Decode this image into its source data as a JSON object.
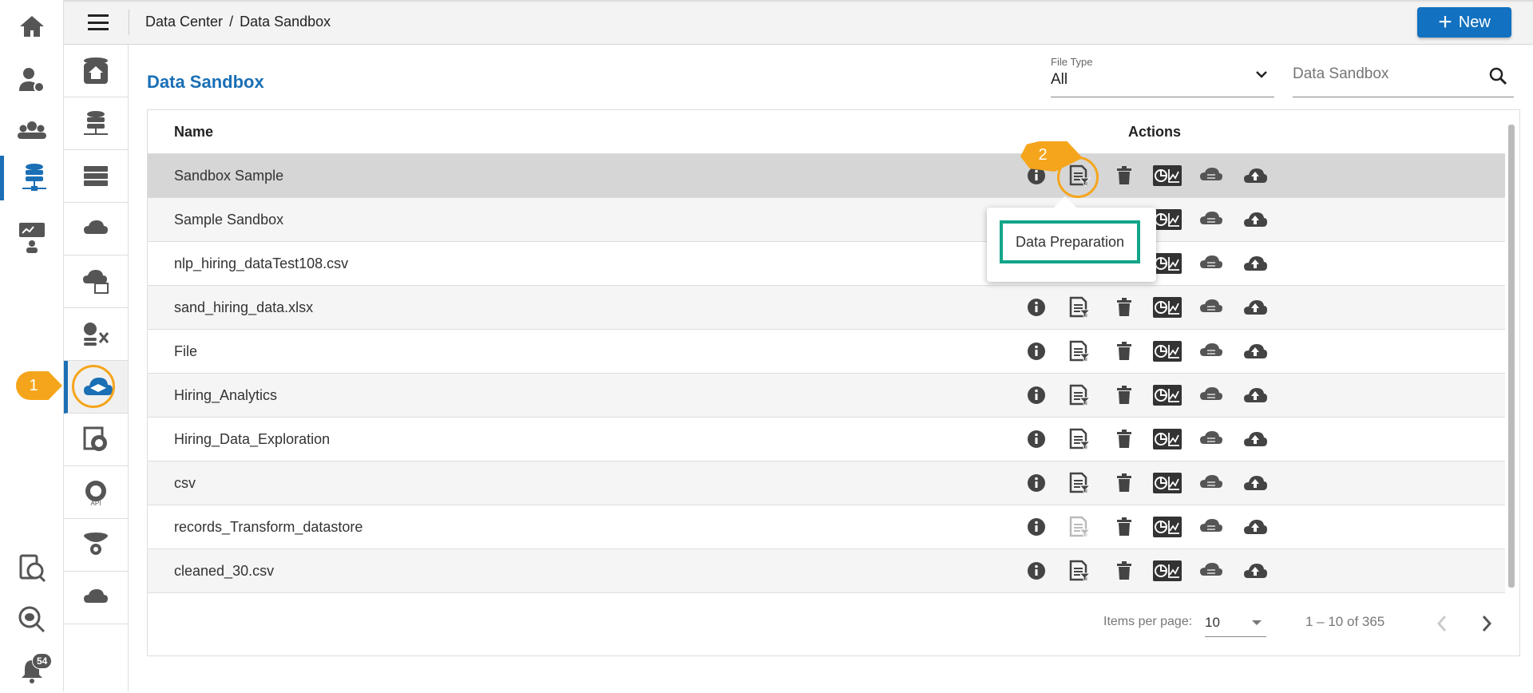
{
  "header": {
    "breadcrumb": [
      "Data Center",
      "/",
      "Data Sandbox"
    ],
    "new_label": "New"
  },
  "left_rail": {
    "notification_count": "54"
  },
  "page": {
    "title": "Data Sandbox",
    "file_type": {
      "label": "File Type",
      "value": "All"
    },
    "search": {
      "placeholder": "Data Sandbox"
    }
  },
  "table": {
    "columns": {
      "name": "Name",
      "actions": "Actions"
    },
    "rows": [
      {
        "name": "Sandbox Sample"
      },
      {
        "name": "Sample Sandbox"
      },
      {
        "name": "nlp_hiring_dataTest108.csv"
      },
      {
        "name": "sand_hiring_data.xlsx"
      },
      {
        "name": "File"
      },
      {
        "name": "Hiring_Analytics"
      },
      {
        "name": "Hiring_Data_Exploration"
      },
      {
        "name": "csv"
      },
      {
        "name": "records_Transform_datastore"
      },
      {
        "name": "cleaned_30.csv"
      }
    ]
  },
  "tooltip": {
    "label": "Data Preparation"
  },
  "callouts": {
    "one": "1",
    "two": "2"
  },
  "pagination": {
    "items_label": "Items per page:",
    "per_page": "10",
    "range": "1 – 10 of 365"
  },
  "colors": {
    "accent": "#1271c0",
    "callout": "#f5a51b",
    "highlight": "#12a58a"
  }
}
